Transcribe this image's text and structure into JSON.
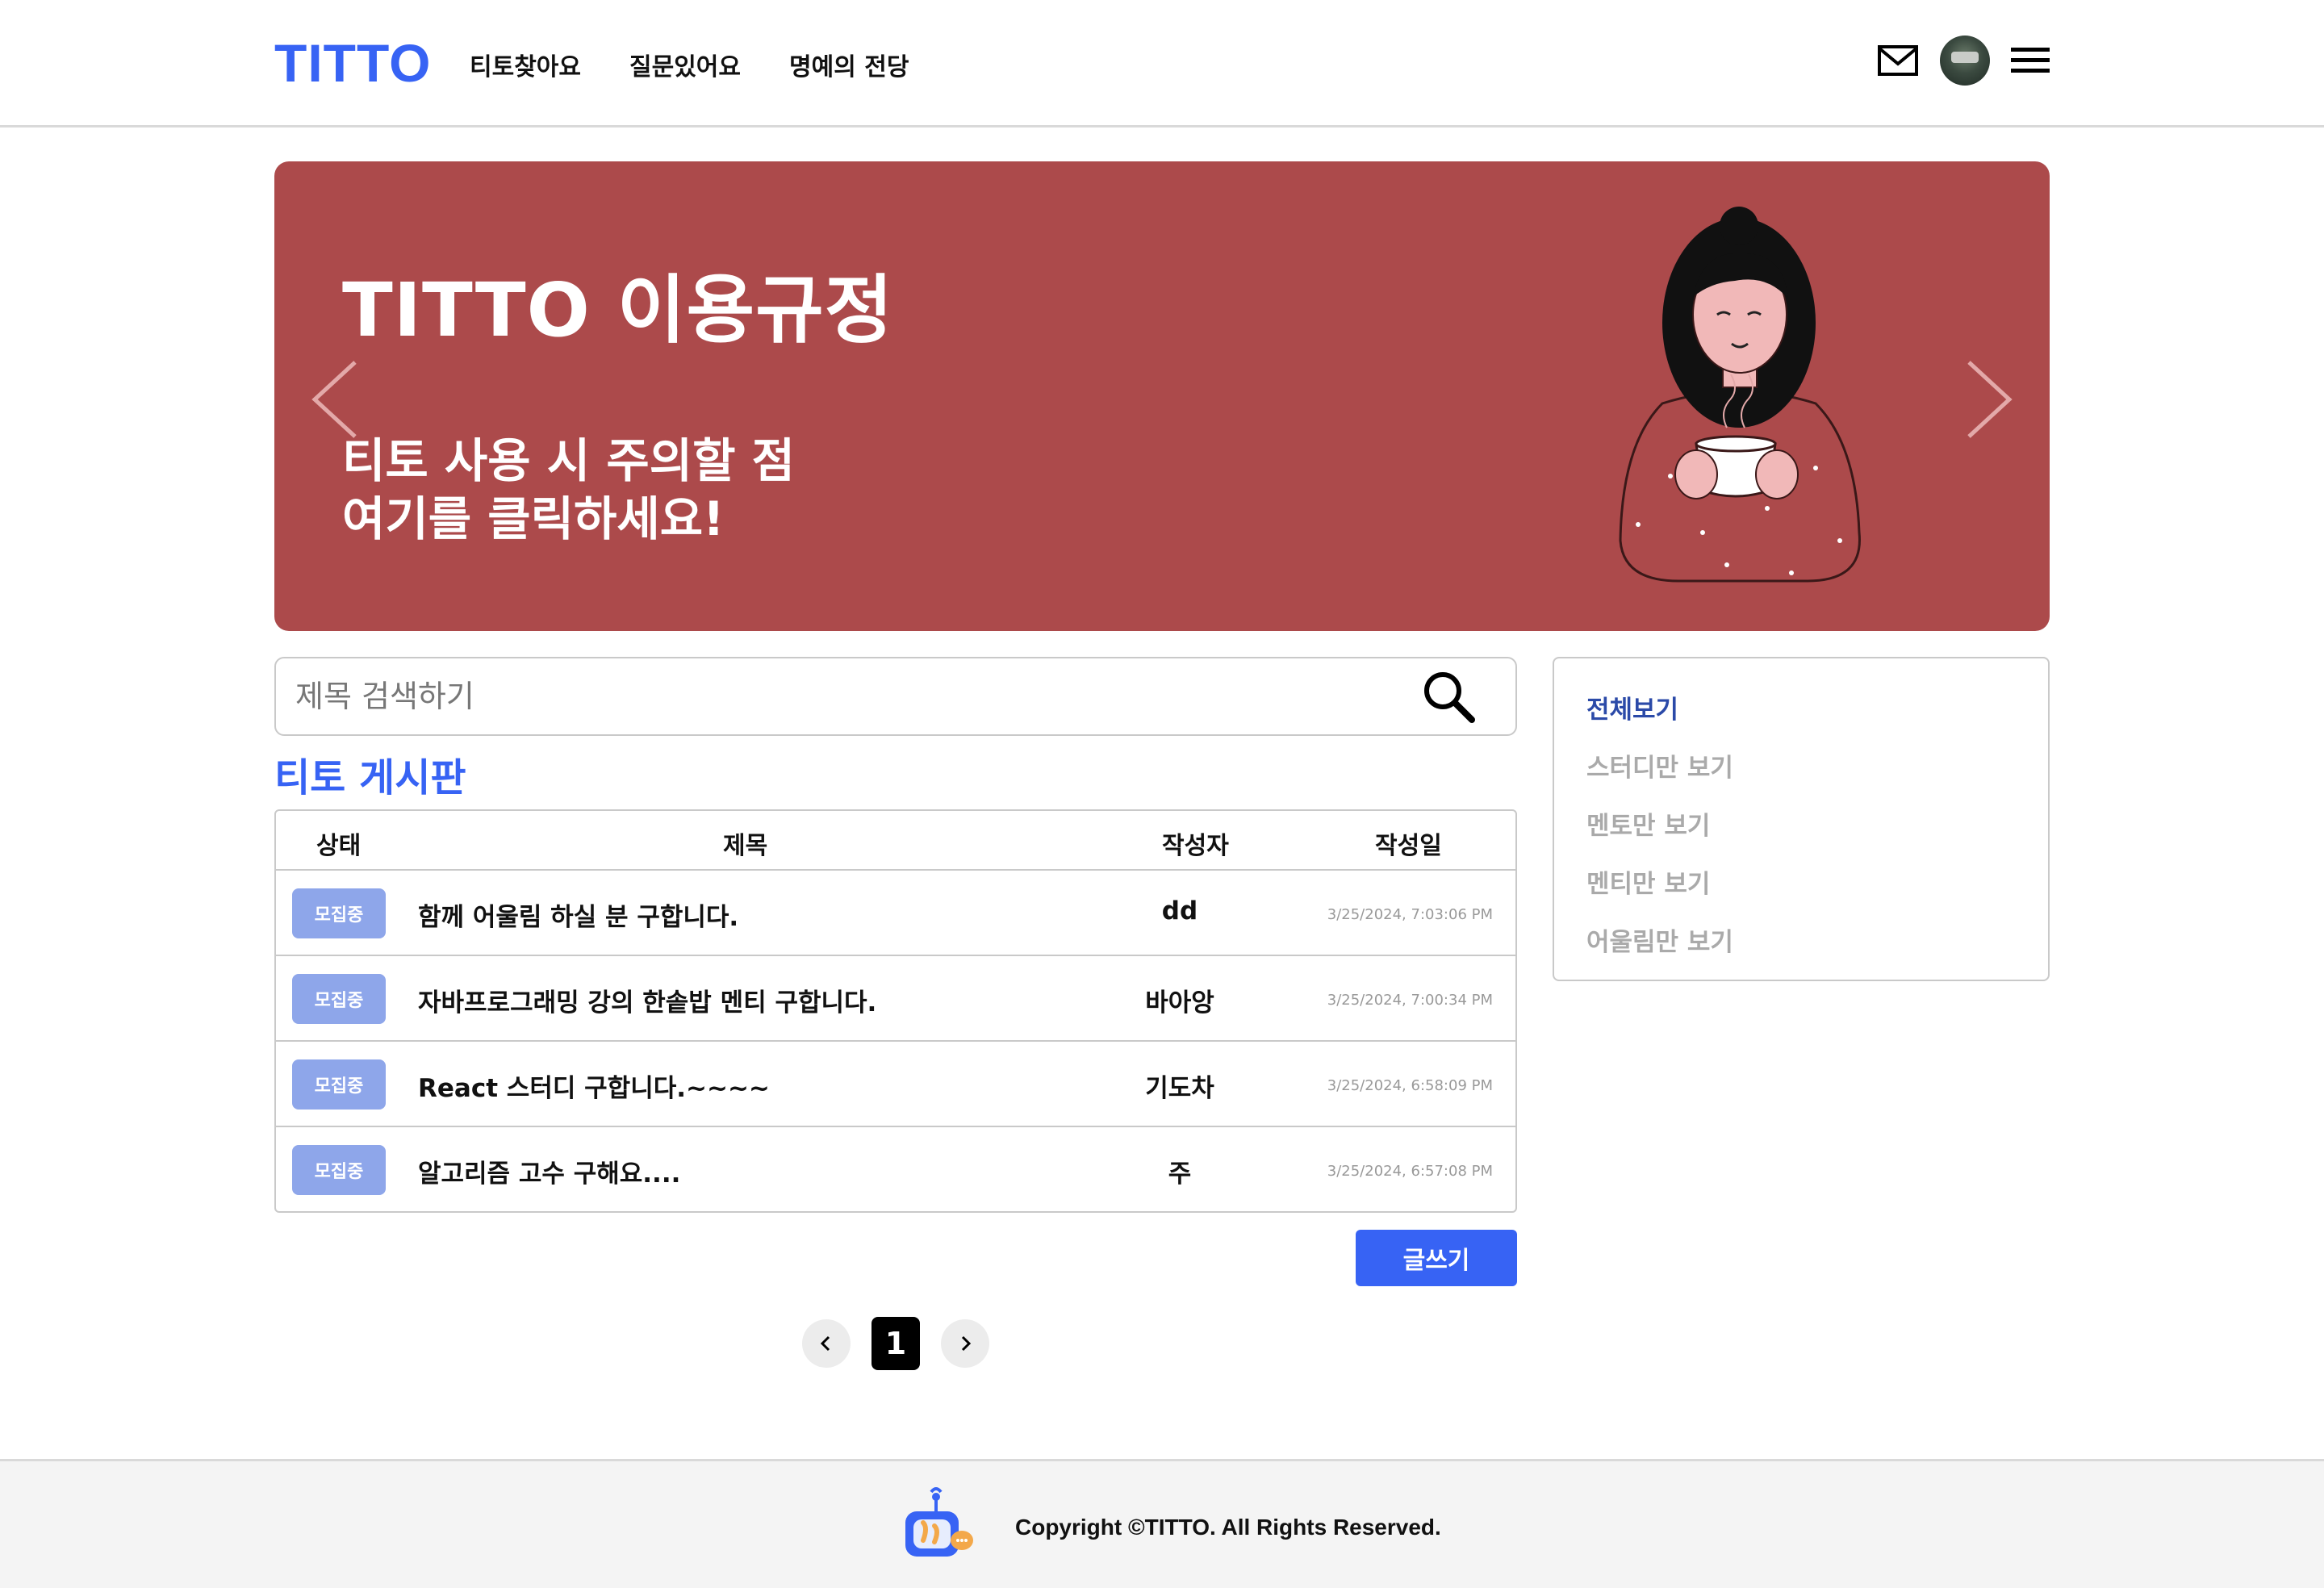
{
  "header": {
    "logo": "TITTO",
    "nav": [
      "티토찾아요",
      "질문있어요",
      "명예의 전당"
    ]
  },
  "banner": {
    "title": "TITTO 이용규정",
    "subtitle": "티토 사용 시 주의할 점\n여기를 클릭하세요!"
  },
  "search": {
    "placeholder": "제목 검색하기"
  },
  "board": {
    "title": "티토 게시판",
    "columns": [
      "상태",
      "제목",
      "작성자",
      "작성일"
    ],
    "rows": [
      {
        "status": "모집중",
        "title": "함께 어울림 하실 분 구합니다.",
        "author": "dd",
        "date": "3/25/2024, 7:03:06 PM"
      },
      {
        "status": "모집중",
        "title": "자바프로그래밍 강의 한솥밥 멘티 구합니다.",
        "author": "바아앙",
        "date": "3/25/2024, 7:00:34 PM"
      },
      {
        "status": "모집중",
        "title": "React 스터디 구합니다.~~~~",
        "author": "기도차",
        "date": "3/25/2024, 6:58:09 PM"
      },
      {
        "status": "모집중",
        "title": "알고리즘 고수 구해요....",
        "author": "주",
        "date": "3/25/2024, 6:57:08 PM"
      }
    ],
    "write_label": "글쓰기"
  },
  "pagination": {
    "current": "1"
  },
  "filter": {
    "items": [
      "전체보기",
      "스터디만 보기",
      "멘토만 보기",
      "멘티만 보기",
      "어울림만 보기"
    ],
    "active_index": 0
  },
  "footer": {
    "copyright": "Copyright ©TITTO. All Rights Reserved."
  },
  "colors": {
    "brand": "#3763f4",
    "banner_bg": "#ac4a4b",
    "badge": "#8ea6ea",
    "filter_active": "#2b4aa8"
  },
  "icons": [
    "mail-icon",
    "avatar",
    "hamburger-menu-icon",
    "chevron-left-icon",
    "chevron-right-icon",
    "search-icon",
    "robot-logo-icon"
  ]
}
